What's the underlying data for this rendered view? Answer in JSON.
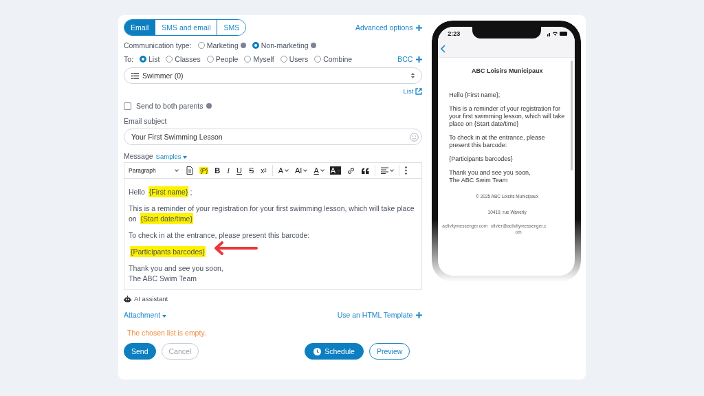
{
  "channel_tabs": [
    {
      "label": "Email",
      "selected": true
    },
    {
      "label": "SMS and email",
      "selected": false
    },
    {
      "label": "SMS",
      "selected": false
    }
  ],
  "advanced_options": "Advanced options",
  "communication_type": {
    "label": "Communication type:",
    "options": [
      {
        "label": "Marketing",
        "selected": false
      },
      {
        "label": "Non-marketing",
        "selected": true
      }
    ]
  },
  "recipients": {
    "label": "To:",
    "options": [
      {
        "label": "List",
        "selected": true
      },
      {
        "label": "Classes",
        "selected": false
      },
      {
        "label": "People",
        "selected": false
      },
      {
        "label": "Myself",
        "selected": false
      },
      {
        "label": "Users",
        "selected": false
      },
      {
        "label": "Combine",
        "selected": false
      }
    ]
  },
  "bcc": "BCC",
  "list_select": {
    "value": "Swimmer (0)"
  },
  "list_link": "List",
  "send_both_parents": {
    "label": "Send to both parents",
    "checked": false
  },
  "subject": {
    "label": "Email subject",
    "value": "Your First Swimming Lesson"
  },
  "message": {
    "label": "Message",
    "samples": "Samples"
  },
  "toolbar": {
    "block_format": "Paragraph",
    "buttons": [
      {
        "kind": "document"
      },
      {
        "kind": "placeholder",
        "label": "{P}"
      },
      {
        "kind": "bold",
        "label": "B"
      },
      {
        "kind": "italic",
        "label": "I"
      },
      {
        "kind": "underline",
        "label": "U"
      },
      {
        "kind": "strike",
        "label": "S"
      },
      {
        "kind": "superscript",
        "label": "x²"
      },
      {
        "kind": "separator"
      },
      {
        "kind": "font-size",
        "label": "A"
      },
      {
        "kind": "font-family",
        "label": "AI"
      },
      {
        "kind": "text-color",
        "label": "A"
      },
      {
        "kind": "highlight",
        "label": "A"
      },
      {
        "kind": "link"
      },
      {
        "kind": "quote"
      },
      {
        "kind": "separator"
      },
      {
        "kind": "align"
      },
      {
        "kind": "separator"
      },
      {
        "kind": "more"
      }
    ]
  },
  "editor_paragraphs": [
    [
      [
        {
          "kind": "text",
          "text": "Hello "
        },
        {
          "kind": "tag",
          "text": "{First name}"
        },
        {
          "kind": "text",
          "text": ";"
        }
      ]
    ],
    [
      [
        {
          "kind": "text",
          "text": "This is a reminder of your registration for your first swimming lesson, which will take place on "
        },
        {
          "kind": "tag",
          "text": "{Start date/time}"
        }
      ]
    ],
    [
      [
        {
          "kind": "text",
          "text": "To check in at the entrance, please present this barcode:"
        }
      ]
    ],
    [
      [
        {
          "kind": "tag",
          "text": "{Participants barcodes}"
        }
      ]
    ],
    [
      [
        {
          "kind": "text",
          "text": "Thank you and see you soon,"
        }
      ],
      [
        {
          "kind": "text",
          "text": "The ABC Swim Team"
        }
      ]
    ]
  ],
  "ai_assistant": "AI assistant",
  "attachment": "Attachment",
  "html_template": "Use an HTML Template",
  "error_message": "The chosen list is empty.",
  "buttons": [
    {
      "label": "Send",
      "kind": "primary",
      "disabled": false
    },
    {
      "label": "Cancel",
      "kind": "outline",
      "disabled": true
    },
    {
      "label": "Schedule",
      "kind": "schedule",
      "disabled": false
    },
    {
      "label": "Preview",
      "kind": "outline",
      "disabled": false
    }
  ],
  "phone": {
    "time": "2:23",
    "sender": "ABC Loisirs Municipaux",
    "body": [
      [
        "Hello {First name};"
      ],
      [
        "This is a reminder of your registration for your first swimming lesson, which will take place on {Start date/time}"
      ],
      [
        "To check in at the entrance, please present this barcode:"
      ],
      [
        "{Participants barcodes}"
      ],
      [
        "Thank you and see you soon,",
        "The ABC Swim Team"
      ]
    ],
    "footer": [
      "© 2025 ABC Loisirs Municipaux",
      "10410, rue Waverly"
    ],
    "footer_links": [
      "activitymessenger.com",
      "olivier@activitymessenger.com"
    ]
  }
}
